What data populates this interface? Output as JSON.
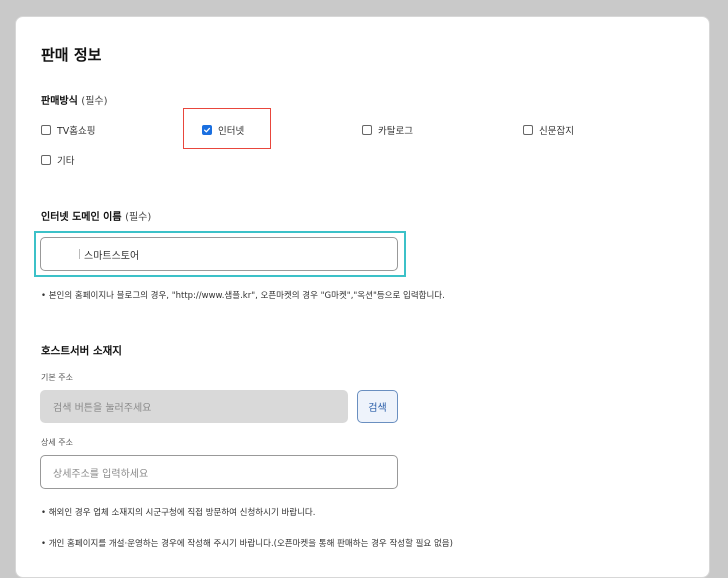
{
  "title": "판매 정보",
  "sales_method": {
    "label": "판매방식",
    "required": "(필수)",
    "options": [
      {
        "label": "TV홈쇼핑",
        "checked": false
      },
      {
        "label": "인터넷",
        "checked": true
      },
      {
        "label": "카탈로그",
        "checked": false
      },
      {
        "label": "신문잡지",
        "checked": false
      },
      {
        "label": "기타",
        "checked": false
      }
    ]
  },
  "domain": {
    "label": "인터넷 도메인 이름",
    "required": "(필수)",
    "value": "스마트스토어",
    "note": "• 본인의 홈페이지나 블로그의 경우, \"http://www.샘플.kr\", 오픈마켓의 경우 \"G마켓\",\"옥션\"등으로 입력합니다."
  },
  "host": {
    "heading": "호스트서버 소재지",
    "basic_label": "기본 주소",
    "basic_placeholder": "검색 버튼을 눌러주세요",
    "search_button": "검색",
    "detail_label": "상세 주소",
    "detail_placeholder": "상세주소를 입력하세요",
    "note1": "• 해외인 경우 업체 소재지의 시군구청에 직접 방문하여 신청하시기 바랍니다.",
    "note2": "• 개인 홈페이지를 개설·운영하는 경우에 작성해 주시기 바랍니다.(오픈마켓을 통해 판매하는 경우 작성할 필요 없음)"
  },
  "colors": {
    "accent": "#1a6fe0",
    "highlight_red": "#e8463c",
    "highlight_teal": "#3cc1c8"
  }
}
